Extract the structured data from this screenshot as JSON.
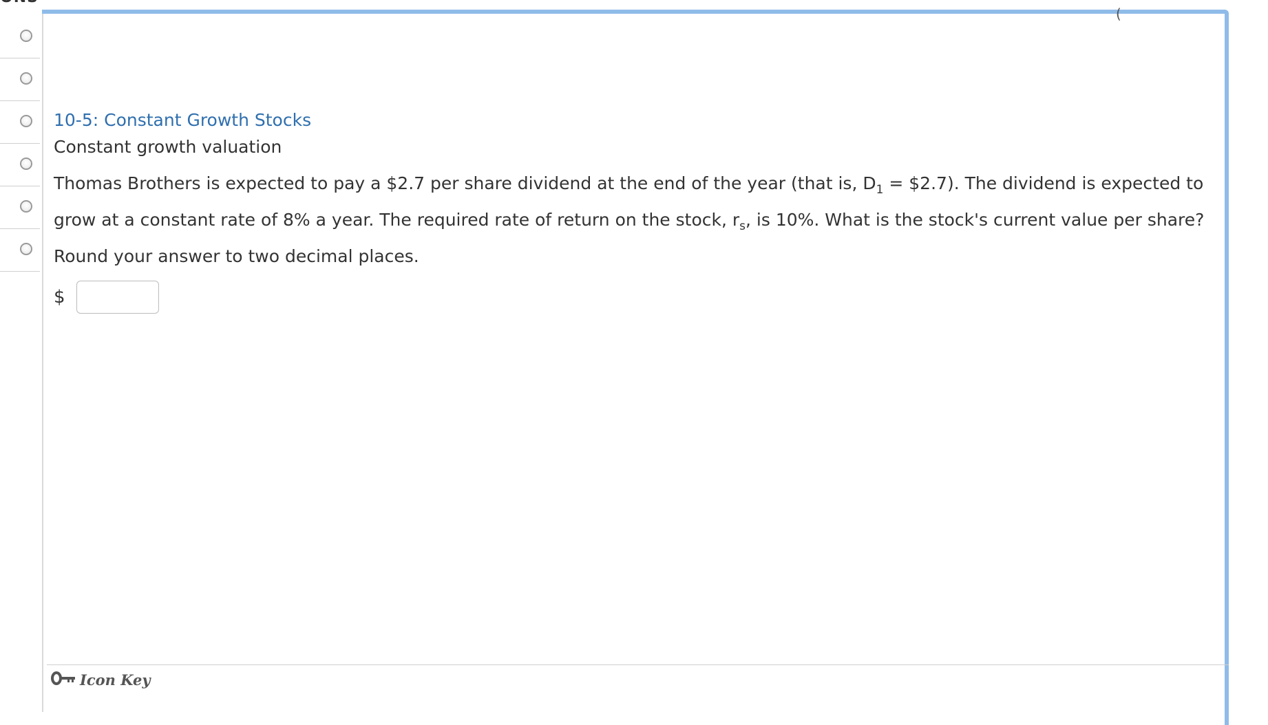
{
  "rail": {
    "top_text": "ONS",
    "items": [
      {
        "selected": false
      },
      {
        "selected": false
      },
      {
        "selected": false
      },
      {
        "selected": false
      },
      {
        "selected": false
      },
      {
        "selected": false
      }
    ]
  },
  "header": {
    "partial_text": "("
  },
  "question": {
    "module_title": "10-5: Constant Growth Stocks",
    "subtitle": "Constant growth valuation",
    "text_1": "Thomas Brothers is expected to pay a $2.7 per share dividend at the end of the year (that is, D",
    "sub_1": "1",
    "text_2": " = $2.7). The dividend is expected to grow at a constant rate of 8% a year. The required rate of return on the stock, r",
    "sub_2": "s",
    "text_3": ", is 10%. What is the stock's current value per share? Round your answer to two decimal places.",
    "currency": "$",
    "answer_value": ""
  },
  "footer": {
    "icon_key_label": "Icon Key",
    "icon": "key-icon"
  },
  "colors": {
    "panel_border": "#8fbbe9",
    "title": "#2f6fae"
  }
}
